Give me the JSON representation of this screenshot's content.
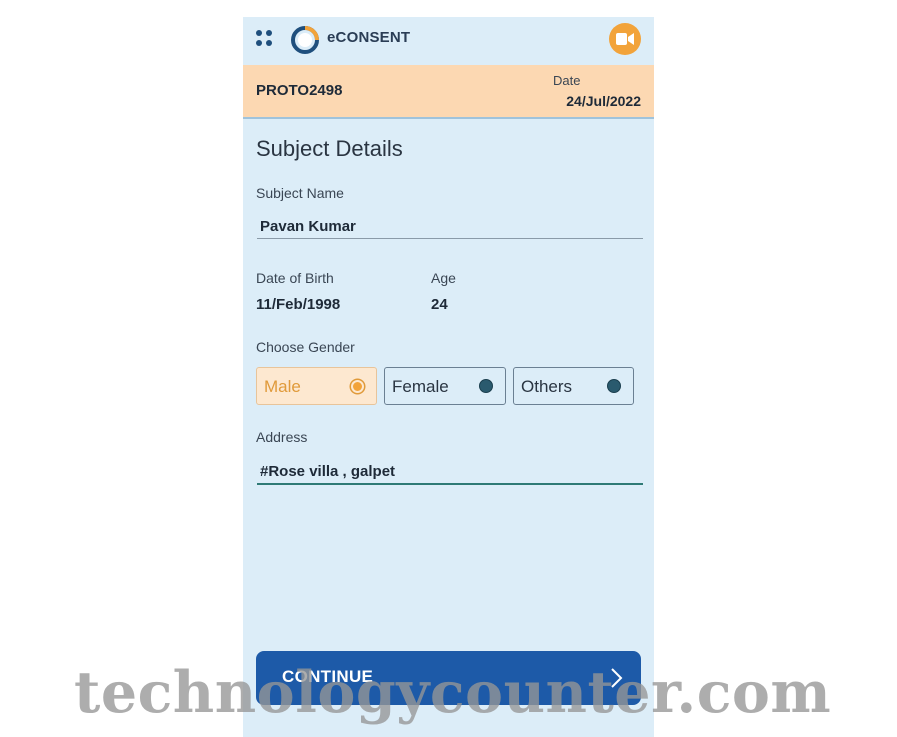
{
  "app": {
    "title": "eCONSENT",
    "menu_icon": "grid-icon",
    "logo_icon": "ring-logo-icon",
    "video_icon": "video-camera-icon",
    "accent_color": "#f2a33a",
    "primary_color": "#1d5aa8"
  },
  "protocol": {
    "id": "PROTO2498",
    "date_label": "Date",
    "date_value": "24/Jul/2022"
  },
  "form": {
    "section_title": "Subject Details",
    "subject_name_label": "Subject Name",
    "subject_name_value": "Pavan Kumar",
    "dob_label": "Date of Birth",
    "dob_value": "11/Feb/1998",
    "age_label": "Age",
    "age_value": "24",
    "gender_label": "Choose Gender",
    "gender_options": [
      {
        "label": "Male",
        "selected": true
      },
      {
        "label": "Female",
        "selected": false
      },
      {
        "label": "Others",
        "selected": false
      }
    ],
    "address_label": "Address",
    "address_value": "#Rose villa , galpet"
  },
  "actions": {
    "continue_label": "CONTINUE",
    "continue_icon": "chevron-right-icon"
  },
  "watermark": {
    "text": "technologycounter.com"
  }
}
